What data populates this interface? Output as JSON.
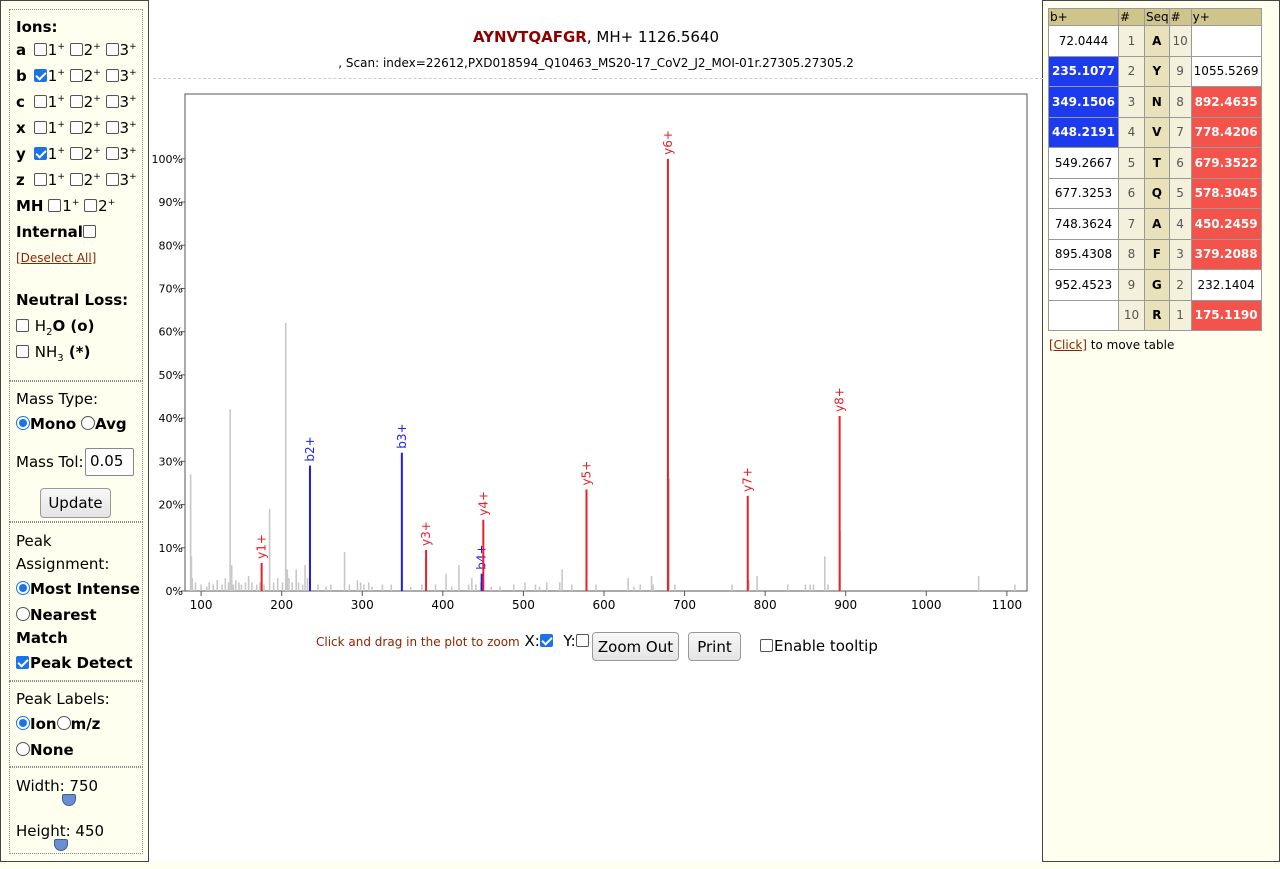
{
  "options": {
    "ions_heading": "Ions:",
    "ion_rows": [
      {
        "ion": "a",
        "checked": [
          false,
          false,
          false
        ]
      },
      {
        "ion": "b",
        "checked": [
          true,
          false,
          false
        ]
      },
      {
        "ion": "c",
        "checked": [
          false,
          false,
          false
        ]
      },
      {
        "ion": "x",
        "checked": [
          false,
          false,
          false
        ]
      },
      {
        "ion": "y",
        "checked": [
          true,
          false,
          false
        ]
      },
      {
        "ion": "z",
        "checked": [
          false,
          false,
          false
        ]
      }
    ],
    "charge_labels": [
      "1",
      "2",
      "3"
    ],
    "mh_label": "MH",
    "internal_label": "Internal",
    "deselect_all": "[Deselect All]",
    "neutral_loss_heading": "Neutral Loss:",
    "h2o_label_parts": [
      "H",
      "2",
      "O (o)"
    ],
    "nh3_label_parts": [
      "NH",
      "3",
      " (*)"
    ],
    "mass_type_heading": "Mass Type:",
    "mono_label": "Mono",
    "avg_label": "Avg",
    "mass_tol_label": "Mass Tol:",
    "mass_tol_value": "0.05",
    "update_button": "Update",
    "peak_assignment_heading_1": "Peak",
    "peak_assignment_heading_2": "Assignment:",
    "most_intense_label": "Most Intense",
    "nearest_label_1": "Nearest",
    "nearest_label_2": "Match",
    "peak_detect_label": "Peak Detect",
    "peak_labels_heading": "Peak Labels:",
    "label_ion": "Ion",
    "label_mz": "m/z",
    "label_none": "None",
    "width_label": "Width: 750",
    "height_label": "Height: 450"
  },
  "header": {
    "sequence": "AYNVTQAFGR",
    "mh_text": ", MH+ 1126.5640",
    "scan_text": ", Scan: index=22612,PXD018594_Q10463_MS20-17_CoV2_J2_MOI-01r.27305.27305.2"
  },
  "controls": {
    "zoom_hint": "Click and drag in the plot to zoom",
    "x_label": "X:",
    "y_label": "Y:",
    "zoom_out": "Zoom Out",
    "print": "Print",
    "enable_tooltip": "Enable tooltip"
  },
  "fragment_table": {
    "headers": [
      "b+",
      "#",
      "Seq",
      "#",
      "y+"
    ],
    "rows": [
      {
        "b": "72.0444",
        "n": "1",
        "aa": "A",
        "n2": "10",
        "y": "",
        "b_hl": false,
        "y_hl": false
      },
      {
        "b": "235.1077",
        "n": "2",
        "aa": "Y",
        "n2": "9",
        "y": "1055.5269",
        "b_hl": true,
        "y_hl": false
      },
      {
        "b": "349.1506",
        "n": "3",
        "aa": "N",
        "n2": "8",
        "y": "892.4635",
        "b_hl": true,
        "y_hl": true
      },
      {
        "b": "448.2191",
        "n": "4",
        "aa": "V",
        "n2": "7",
        "y": "778.4206",
        "b_hl": true,
        "y_hl": true
      },
      {
        "b": "549.2667",
        "n": "5",
        "aa": "T",
        "n2": "6",
        "y": "679.3522",
        "b_hl": false,
        "y_hl": true
      },
      {
        "b": "677.3253",
        "n": "6",
        "aa": "Q",
        "n2": "5",
        "y": "578.3045",
        "b_hl": false,
        "y_hl": true
      },
      {
        "b": "748.3624",
        "n": "7",
        "aa": "A",
        "n2": "4",
        "y": "450.2459",
        "b_hl": false,
        "y_hl": true
      },
      {
        "b": "895.4308",
        "n": "8",
        "aa": "F",
        "n2": "3",
        "y": "379.2088",
        "b_hl": false,
        "y_hl": true
      },
      {
        "b": "952.4523",
        "n": "9",
        "aa": "G",
        "n2": "2",
        "y": "232.1404",
        "b_hl": false,
        "y_hl": false
      },
      {
        "b": "",
        "n": "10",
        "aa": "R",
        "n2": "1",
        "y": "175.1190",
        "b_hl": false,
        "y_hl": true
      }
    ],
    "move_link": "[Click]",
    "move_text": " to move table"
  },
  "colors": {
    "b_ion": "#1c1cf0",
    "y_ion": "#e8202a",
    "background_peak": "#c8c8c8",
    "seq_title": "#8b0000",
    "b_highlight": "#1c3bee",
    "y_highlight": "#f4534b"
  },
  "chart_data": {
    "type": "bar",
    "xlim": [
      80,
      1125
    ],
    "ylim": [
      0,
      115
    ],
    "xticks": [
      100,
      200,
      300,
      400,
      500,
      600,
      700,
      800,
      900,
      1000,
      1100
    ],
    "yticks": [
      0,
      10,
      20,
      30,
      40,
      50,
      60,
      70,
      80,
      90,
      100
    ],
    "ytick_suffix": "%",
    "grid": false,
    "annotated_peaks": [
      {
        "label": "y1+",
        "mz": 175.12,
        "intensity": 6.5,
        "series": "y"
      },
      {
        "label": "b2+",
        "mz": 235.11,
        "intensity": 29,
        "series": "b"
      },
      {
        "label": "b3+",
        "mz": 349.15,
        "intensity": 32,
        "series": "b"
      },
      {
        "label": "y3+",
        "mz": 379.21,
        "intensity": 9.5,
        "series": "y"
      },
      {
        "label": "b4+",
        "mz": 448.22,
        "intensity": 4,
        "series": "b"
      },
      {
        "label": "y4+",
        "mz": 450.25,
        "intensity": 16.5,
        "series": "y"
      },
      {
        "label": "y5+",
        "mz": 578.3,
        "intensity": 23.5,
        "series": "y"
      },
      {
        "label": "y6+",
        "mz": 679.35,
        "intensity": 100,
        "series": "y"
      },
      {
        "label": "y7+",
        "mz": 778.42,
        "intensity": 22,
        "series": "y"
      },
      {
        "label": "y8+",
        "mz": 892.46,
        "intensity": 40.5,
        "series": "y"
      }
    ],
    "other_peaks": [
      [
        87,
        27
      ],
      [
        88,
        8
      ],
      [
        89,
        3
      ],
      [
        93,
        2
      ],
      [
        100,
        1.5
      ],
      [
        107,
        1
      ],
      [
        110,
        2
      ],
      [
        115,
        1.5
      ],
      [
        120,
        2.5
      ],
      [
        126,
        1.5
      ],
      [
        130,
        3
      ],
      [
        134,
        2
      ],
      [
        136,
        42
      ],
      [
        138,
        6
      ],
      [
        140,
        1.5
      ],
      [
        143,
        2.5
      ],
      [
        147,
        2
      ],
      [
        150,
        1.5
      ],
      [
        155,
        2
      ],
      [
        159,
        3.5
      ],
      [
        163,
        2
      ],
      [
        169,
        1.5
      ],
      [
        173,
        2
      ],
      [
        178,
        1.5
      ],
      [
        185,
        19
      ],
      [
        190,
        2
      ],
      [
        195,
        3
      ],
      [
        201,
        2
      ],
      [
        205,
        62
      ],
      [
        207,
        5
      ],
      [
        209,
        3
      ],
      [
        213,
        2
      ],
      [
        218,
        5
      ],
      [
        221,
        2
      ],
      [
        226,
        1.5
      ],
      [
        229,
        6
      ],
      [
        232,
        3
      ],
      [
        245,
        1.5
      ],
      [
        255,
        1
      ],
      [
        261,
        1.5
      ],
      [
        278,
        9
      ],
      [
        284,
        1.5
      ],
      [
        294,
        2.5
      ],
      [
        298,
        2
      ],
      [
        302,
        1.5
      ],
      [
        308,
        2
      ],
      [
        312,
        1
      ],
      [
        325,
        1.5
      ],
      [
        336,
        1.5
      ],
      [
        360,
        1
      ],
      [
        374,
        1.5
      ],
      [
        391,
        1.5
      ],
      [
        404,
        4
      ],
      [
        411,
        1
      ],
      [
        420,
        6
      ],
      [
        432,
        1.5
      ],
      [
        436,
        3
      ],
      [
        441,
        1.5
      ],
      [
        447,
        2
      ],
      [
        460,
        1
      ],
      [
        471,
        1
      ],
      [
        488,
        1.5
      ],
      [
        502,
        2
      ],
      [
        515,
        1.5
      ],
      [
        520,
        1
      ],
      [
        529,
        2
      ],
      [
        545,
        2
      ],
      [
        548,
        5
      ],
      [
        560,
        1.5
      ],
      [
        578,
        1
      ],
      [
        590,
        1.5
      ],
      [
        630,
        3
      ],
      [
        637,
        1
      ],
      [
        645,
        1.5
      ],
      [
        659,
        3.5
      ],
      [
        661,
        1.5
      ],
      [
        681,
        26
      ],
      [
        688,
        1.5
      ],
      [
        759,
        1.5
      ],
      [
        780,
        2.5
      ],
      [
        790,
        3.5
      ],
      [
        828,
        1.5
      ],
      [
        850,
        1.5
      ],
      [
        856,
        1.5
      ],
      [
        860,
        1.5
      ],
      [
        874,
        8
      ],
      [
        878,
        1.5
      ],
      [
        893,
        14
      ],
      [
        1065,
        3.5
      ],
      [
        1110,
        1.5
      ]
    ]
  }
}
